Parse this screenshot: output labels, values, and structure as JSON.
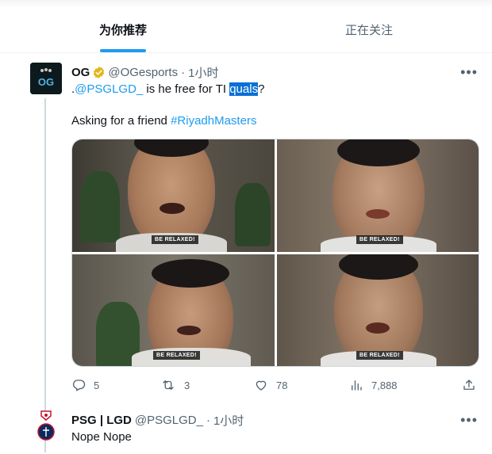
{
  "tabs": [
    {
      "label": "为你推荐",
      "active": true
    },
    {
      "label": "正在关注",
      "active": false
    }
  ],
  "tweet": {
    "author_name": "OG",
    "handle": "@OGesports",
    "separator": "·",
    "time": "1小时",
    "text_prefix": ".",
    "mention": "@PSGLGD_",
    "text_middle": " is he free for TI ",
    "text_selected": "quals",
    "text_suffix": "?",
    "line2_prefix": "Asking for a friend ",
    "hashtag": "#RiyadhMasters",
    "media_captions": [
      "BE RELAXED!",
      "BE RELAXED!",
      "BE RELAXED!",
      "BE RELAXED!"
    ],
    "stats": {
      "replies": "5",
      "retweets": "3",
      "likes": "78",
      "views": "7,888"
    }
  },
  "reply": {
    "author_name": "PSG | LGD",
    "handle": "@PSGLGD_",
    "separator": "·",
    "time": "1小时",
    "text": "Nope Nope"
  },
  "icons": {
    "verified": "verified-badge-icon",
    "more": "more-horizontal-icon",
    "reply": "reply-icon",
    "retweet": "retweet-icon",
    "like": "heart-icon",
    "views": "views-chart-icon",
    "share": "share-icon"
  },
  "colors": {
    "accent": "#1d9bf0",
    "verified_gold": "#e2b719",
    "text_primary": "#0f1419",
    "text_secondary": "#536471",
    "selection": "#0b6fd6"
  }
}
